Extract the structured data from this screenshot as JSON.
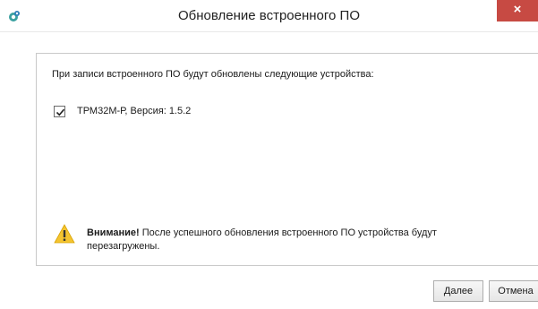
{
  "window": {
    "title": "Обновление встроенного ПО",
    "close_glyph": "×"
  },
  "panel": {
    "intro_text": "При записи встроенного ПО будут обновлены следующие устройства:",
    "devices": [
      {
        "label": "ТРМ32М-Р, Версия: 1.5.2",
        "checked": true
      }
    ],
    "warning": {
      "bold": "Внимание!",
      "text": " После успешного обновления встроенного ПО устройства будут перезагружены."
    }
  },
  "buttons": {
    "next_label": "Далее",
    "cancel_label": "Отмена"
  },
  "colors": {
    "close_button": "#c74a43",
    "warning_icon": "#f4c430"
  }
}
